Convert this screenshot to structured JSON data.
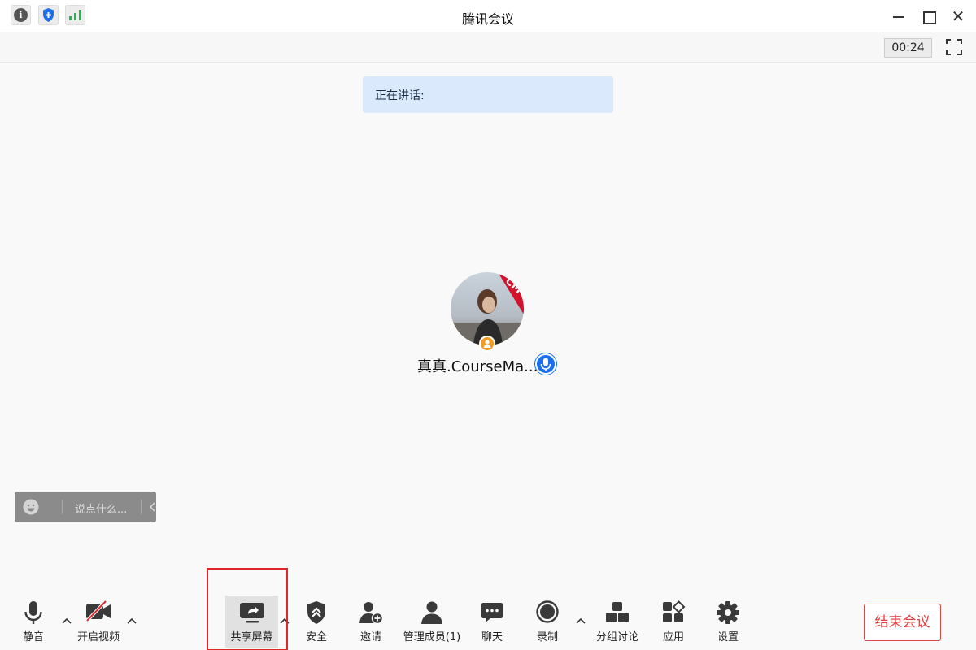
{
  "window": {
    "title": "腾讯会议",
    "close_glyph": "✕"
  },
  "infobar": {
    "timer": "00:24",
    "icons": [
      "info-icon",
      "shield-icon",
      "signal-icon",
      "fullscreen-icon"
    ]
  },
  "speaking": {
    "label": "正在讲话:"
  },
  "participant": {
    "name": "真真.CourseMa...",
    "avatar_tag": "CM",
    "badges": [
      "person-icon",
      "microphone-icon"
    ]
  },
  "chat_input": {
    "placeholder": "说点什么..."
  },
  "toolbar": {
    "mute": "静音",
    "video": "开启视频",
    "share": "共享屏幕",
    "security": "安全",
    "invite": "邀请",
    "members": "管理成员(1)",
    "chat": "聊天",
    "record": "录制",
    "breakout": "分组讨论",
    "apps": "应用",
    "settings": "设置",
    "end_meeting": "结束会议"
  },
  "colors": {
    "accent_blue": "#1a6ff0",
    "danger_red": "#e23c3f",
    "speaking_bg": "#dbe9fc",
    "signal_green": "#1fb84a",
    "highlight_red": "#e0262b"
  }
}
